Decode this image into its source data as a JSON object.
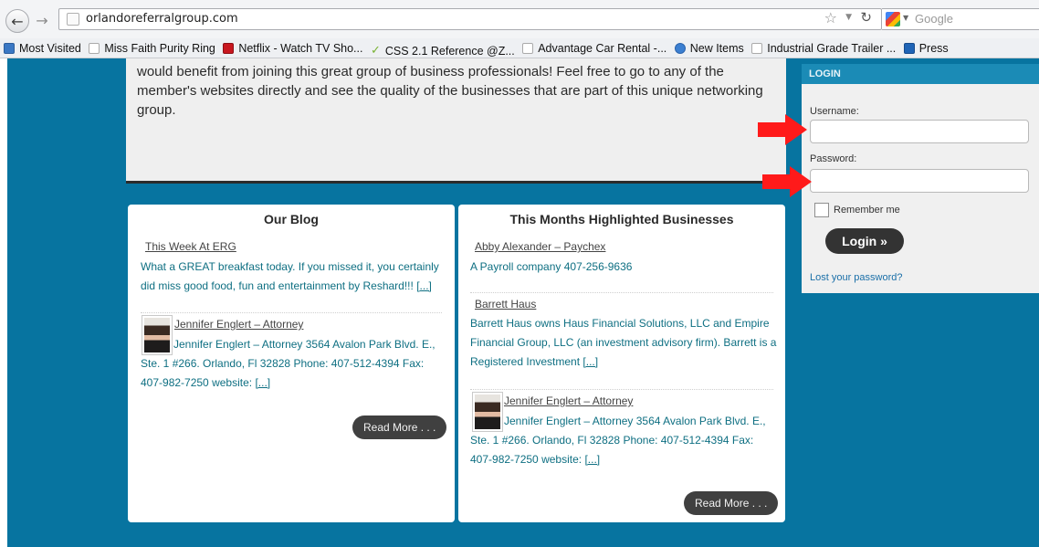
{
  "browser": {
    "url": "orlandoreferralgroup.com",
    "search_placeholder": "Google",
    "bookmarks": [
      {
        "label": "Most Visited",
        "icon": "most-visited-icon"
      },
      {
        "label": "Miss Faith Purity Ring",
        "icon": "page-icon"
      },
      {
        "label": "Netflix - Watch TV Sho...",
        "icon": "netflix-icon"
      },
      {
        "label": "CSS 2.1 Reference @Z...",
        "icon": "checkmark-icon"
      },
      {
        "label": "Advantage Car Rental -...",
        "icon": "page-icon"
      },
      {
        "label": "New Items",
        "icon": "ie-icon"
      },
      {
        "label": "Industrial Grade Trailer ...",
        "icon": "page-icon"
      },
      {
        "label": "Press",
        "icon": "press-icon"
      }
    ]
  },
  "intro_text": "would benefit from joining this great group of business professionals! Feel free to go to any of the member's websites directly and see the quality of the businesses that are part of this unique networking group.",
  "blog": {
    "title": "Our Blog",
    "post1": {
      "title": "This Week At ERG",
      "excerpt": "What a GREAT breakfast today. If you missed it, you certainly did miss good food, fun and entertainment by Reshard!!!",
      "more": "[...]"
    },
    "post2": {
      "title": "Jennifer Englert – Attorney",
      "excerpt": "Jennifer Englert – Attorney 3564 Avalon Park Blvd. E., Ste. 1 #266. Orlando, Fl 32828 Phone: 407-512-4394 Fax: 407-982-7250 website:",
      "more": "[...]"
    },
    "read_more": "Read More . . ."
  },
  "highlighted": {
    "title": "This Months Highlighted Businesses",
    "item1": {
      "title": "Abby Alexander – Paychex",
      "desc": "A Payroll company 407-256-9636"
    },
    "item2": {
      "title": "Barrett Haus",
      "desc": "Barrett Haus owns Haus Financial Solutions, LLC and Empire Financial Group, LLC (an investment advisory firm). Barrett is a Registered Investment",
      "more": "[...]"
    },
    "item3": {
      "title": "Jennifer Englert – Attorney",
      "desc": "Jennifer Englert – Attorney 3564 Avalon Park Blvd. E., Ste. 1 #266. Orlando, Fl 32828 Phone: 407-512-4394 Fax: 407-982-7250 website:",
      "more": "[...]"
    },
    "read_more": "Read More . . ."
  },
  "login": {
    "title": "LOGIN",
    "username_label": "Username:",
    "password_label": "Password:",
    "remember_label": "Remember me",
    "button_label": "Login »",
    "lost_password": "Lost your password?"
  },
  "colors": {
    "page_background": "#0774a0",
    "login_header": "#1b8bb6",
    "annotation_arrow": "#ff1a1a",
    "link_teal": "#0e6f82"
  }
}
